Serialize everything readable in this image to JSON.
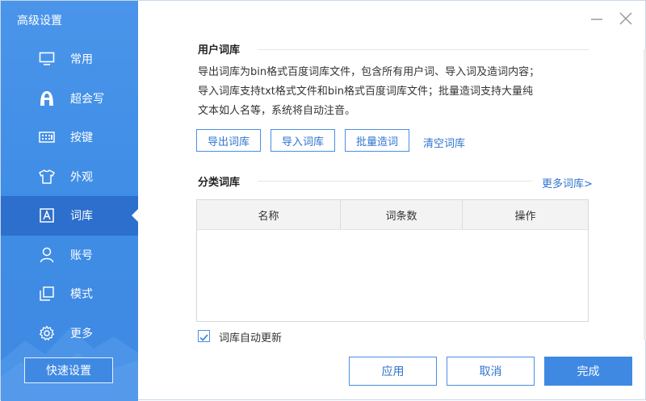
{
  "window": {
    "title": "高级设置"
  },
  "sidebar": {
    "items": [
      {
        "label": "常用",
        "icon": "monitor-icon"
      },
      {
        "label": "超会写",
        "icon": "super-write-icon"
      },
      {
        "label": "按键",
        "icon": "keyboard-icon"
      },
      {
        "label": "外观",
        "icon": "tshirt-icon"
      },
      {
        "label": "词库",
        "icon": "lexicon-icon",
        "active": true
      },
      {
        "label": "账号",
        "icon": "user-icon"
      },
      {
        "label": "模式",
        "icon": "mode-icon"
      },
      {
        "label": "更多",
        "icon": "gear-icon"
      }
    ],
    "quick_button": "快速设置"
  },
  "user_lexicon": {
    "title": "用户词库",
    "description_lines": [
      "导出词库为bin格式百度词库文件，包含所有用户词、导入词及造词内容；",
      "导入词库支持txt格式文件和bin格式百度词库文件；批量造词支持大量纯",
      "文本如人名等，系统将自动注音。"
    ],
    "buttons": {
      "export": "导出词库",
      "import": "导入词库",
      "batch": "批量造词"
    },
    "clear_link": "清空词库"
  },
  "category_lexicon": {
    "title": "分类词库",
    "more_link": "更多词库>",
    "columns": [
      "名称",
      "词条数",
      "操作"
    ],
    "rows": []
  },
  "auto_update": {
    "label": "词库自动更新",
    "checked": true
  },
  "footer": {
    "apply": "应用",
    "cancel": "取消",
    "done": "完成"
  },
  "colors": {
    "accent": "#3f89e2",
    "sidebar_active": "#2c6fcd",
    "link": "#2f74d0"
  }
}
